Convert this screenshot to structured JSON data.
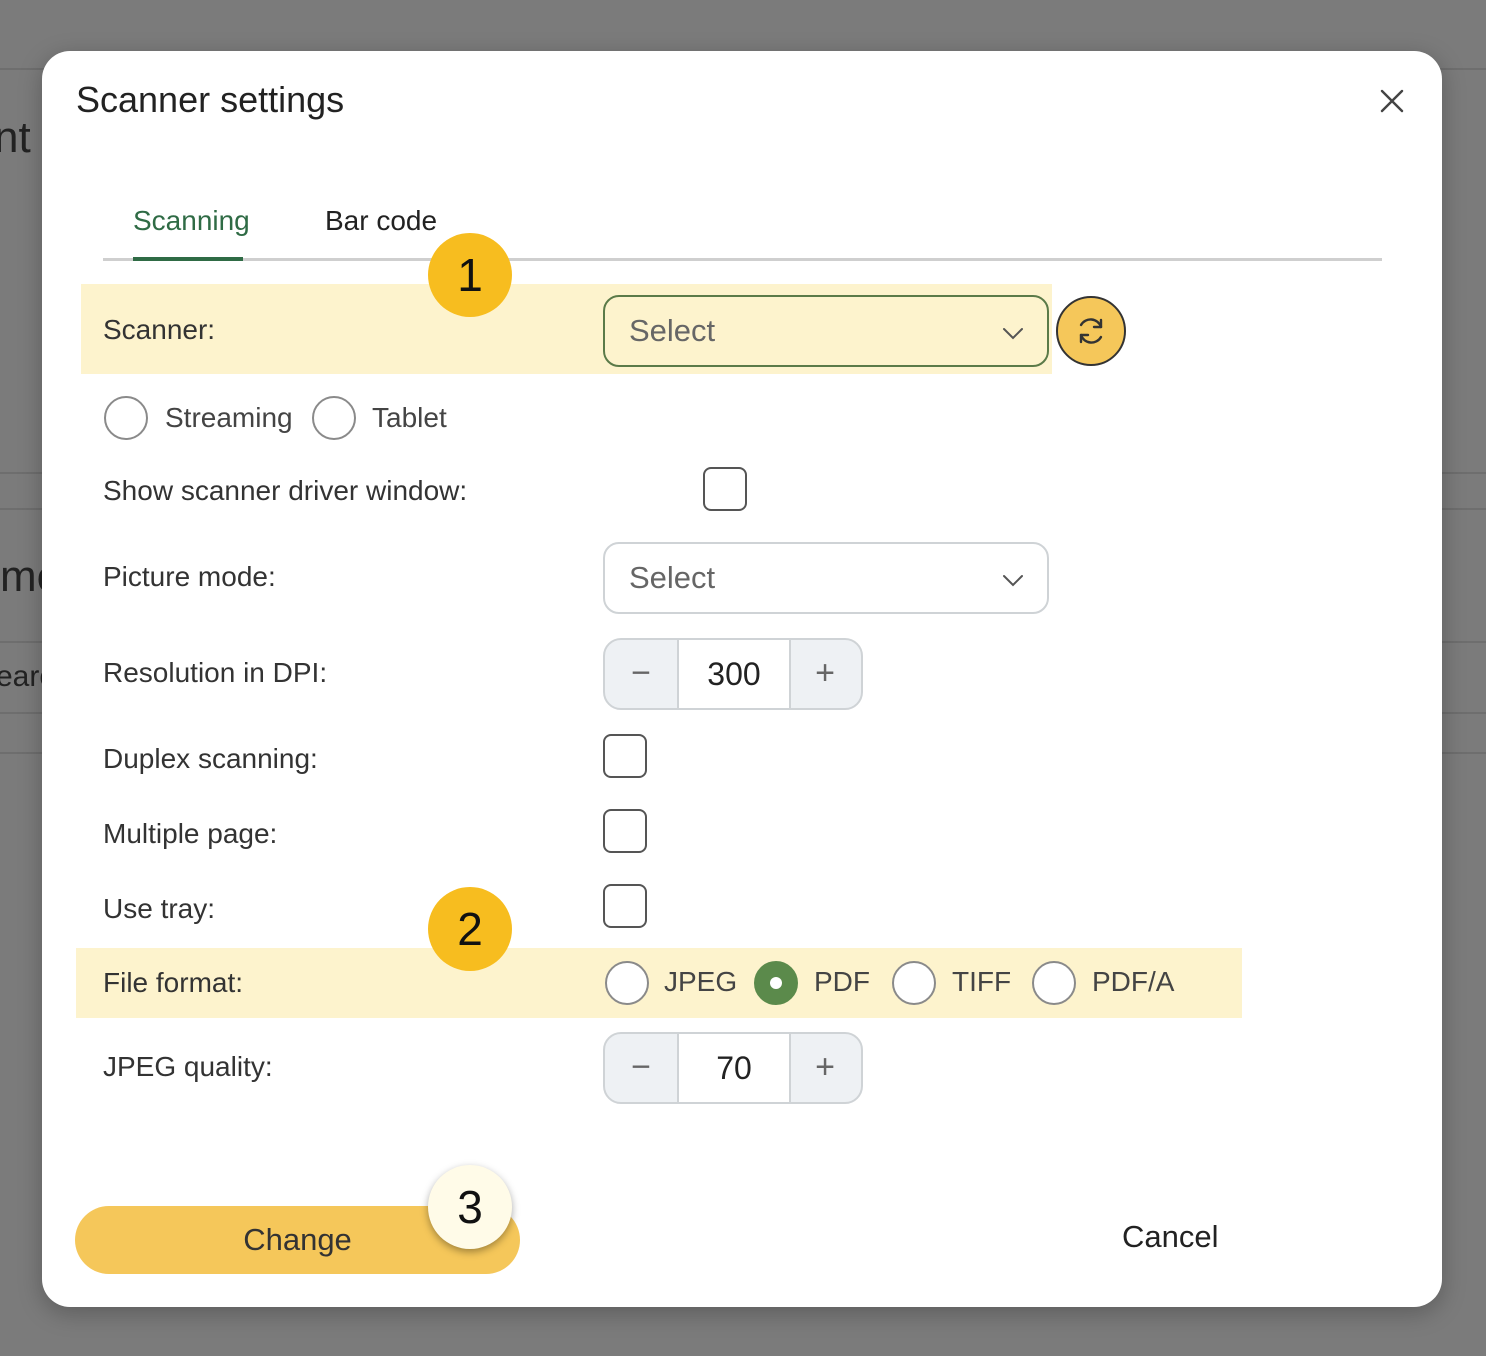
{
  "background": {
    "fragments": [
      "nt (",
      "me",
      "earc"
    ]
  },
  "dialog": {
    "title": "Scanner settings",
    "close_icon": "close-icon"
  },
  "tabs": [
    {
      "label": "Scanning",
      "active": true
    },
    {
      "label": "Bar code",
      "active": false
    }
  ],
  "scanner": {
    "label": "Scanner:",
    "select_value": "Select",
    "refresh_icon": "refresh-icon"
  },
  "scan_mode": {
    "options": [
      {
        "label": "Streaming",
        "checked": false
      },
      {
        "label": "Tablet",
        "checked": false
      }
    ]
  },
  "show_driver_window": {
    "label": "Show scanner driver window:",
    "checked": false
  },
  "picture_mode": {
    "label": "Picture mode:",
    "select_value": "Select"
  },
  "resolution": {
    "label": "Resolution in DPI:",
    "value": "300",
    "minus": "−",
    "plus": "+"
  },
  "duplex": {
    "label": "Duplex scanning:",
    "checked": false
  },
  "multiple_page": {
    "label": "Multiple page:",
    "checked": false
  },
  "use_tray": {
    "label": "Use tray:",
    "checked": false
  },
  "file_format": {
    "label": "File format:",
    "options": [
      {
        "label": "JPEG",
        "checked": false
      },
      {
        "label": "PDF",
        "checked": true
      },
      {
        "label": "TIFF",
        "checked": false
      },
      {
        "label": "PDF/A",
        "checked": false
      }
    ]
  },
  "jpeg_quality": {
    "label": "JPEG quality:",
    "value": "70",
    "minus": "−",
    "plus": "+"
  },
  "footer": {
    "change_label": "Change",
    "cancel_label": "Cancel"
  },
  "callouts": [
    "1",
    "2",
    "3"
  ],
  "colors": {
    "accent_green": "#2f6b45",
    "radio_checked": "#5b8a4b",
    "highlight": "#fdf3cd",
    "button_yellow": "#f5c75a",
    "badge_yellow": "#f7bd1f"
  }
}
